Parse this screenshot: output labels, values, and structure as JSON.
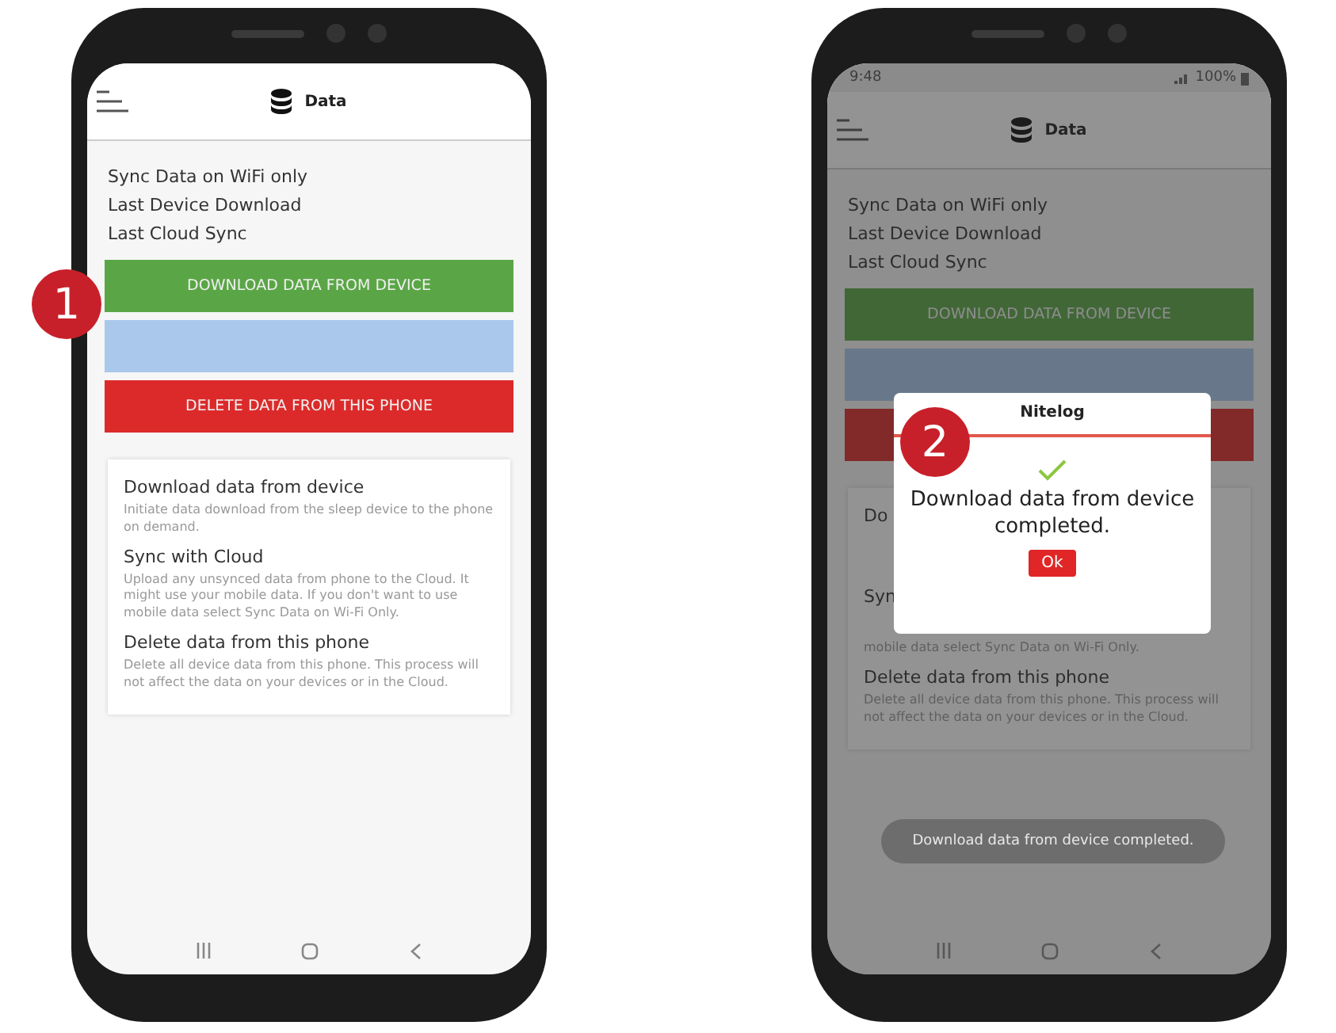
{
  "phones": [
    {
      "marker": "1",
      "dimmed": false,
      "header": {
        "title": "Data"
      },
      "settings": [
        "Sync Data on WiFi only",
        "Last Device Download",
        "Last Cloud Sync"
      ],
      "buttons": [
        {
          "kind": "download",
          "label": "DOWNLOAD DATA FROM DEVICE"
        },
        {
          "kind": "sync"
        },
        {
          "kind": "delete",
          "label": "DELETE DATA FROM THIS PHONE"
        }
      ],
      "help": [
        {
          "heading": "Download data from device",
          "text": "Initiate data download from the sleep device to the phone on demand."
        },
        {
          "heading": "Sync with Cloud",
          "text": "Upload any unsynced data from phone to the Cloud. It might use your mobile data. If you don't want to use mobile data select Sync Data on Wi-Fi Only."
        },
        {
          "heading": "Delete data from this phone",
          "text": "Delete all device data from this phone. This process will not affect the data on your devices or in the Cloud."
        }
      ]
    },
    {
      "marker": "2",
      "dimmed": true,
      "status_bar": {
        "time": "9:48",
        "battery": "100%"
      },
      "header": {
        "title": "Data"
      },
      "settings": [
        "Sync Data on WiFi only",
        "Last Device Download",
        "Last Cloud Sync"
      ],
      "buttons": [
        {
          "kind": "download",
          "label": "DOWNLOAD DATA FROM DEVICE"
        },
        {
          "kind": "sync"
        },
        {
          "kind": "delete"
        }
      ],
      "help": [
        {
          "heading": "Do"
        },
        {
          "heading": "Syn",
          "text": "mobile data select Sync Data on Wi-Fi Only."
        },
        {
          "heading": "Delete data from this phone",
          "text": "Delete all device data from this phone. This process will not affect the data on your devices or in the Cloud."
        }
      ],
      "dialog": {
        "title": "Nitelog",
        "message": "Download data from device completed.",
        "button": "Ok"
      },
      "toast": "Download data from device completed."
    }
  ]
}
